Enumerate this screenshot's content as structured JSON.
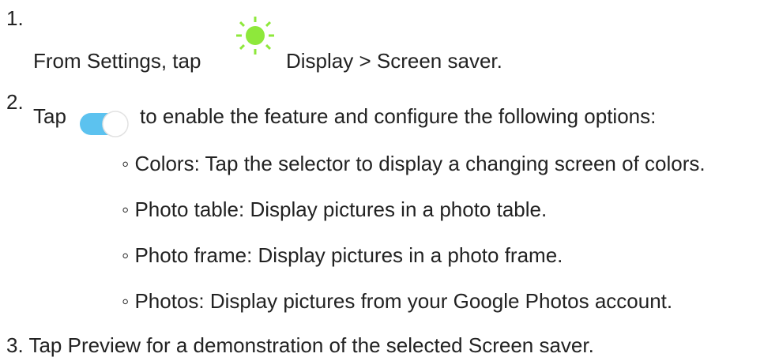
{
  "steps": [
    {
      "number": "1.",
      "prefix": "From Settings, tap",
      "icon": "display-sun-icon",
      "suffix": "Display > Screen saver."
    },
    {
      "number": "2.",
      "prefix": "Tap",
      "icon": "toggle-switch-icon",
      "suffix": "to enable the feature and configure the following options:",
      "options": [
        "Colors: Tap the selector to display a changing screen of colors.",
        "Photo table: Display pictures in a photo table.",
        "Photo frame: Display pictures in a photo frame.",
        "Photos: Display pictures from your Google Photos account."
      ]
    },
    {
      "number": "3.",
      "text": "Tap Preview for a demonstration of the selected Screen saver."
    }
  ],
  "bullet": "◦",
  "colors": {
    "text": "#222222",
    "sun": "#8ee83b",
    "toggle_track": "#5cc2ef",
    "toggle_knob": "#ffffff"
  }
}
